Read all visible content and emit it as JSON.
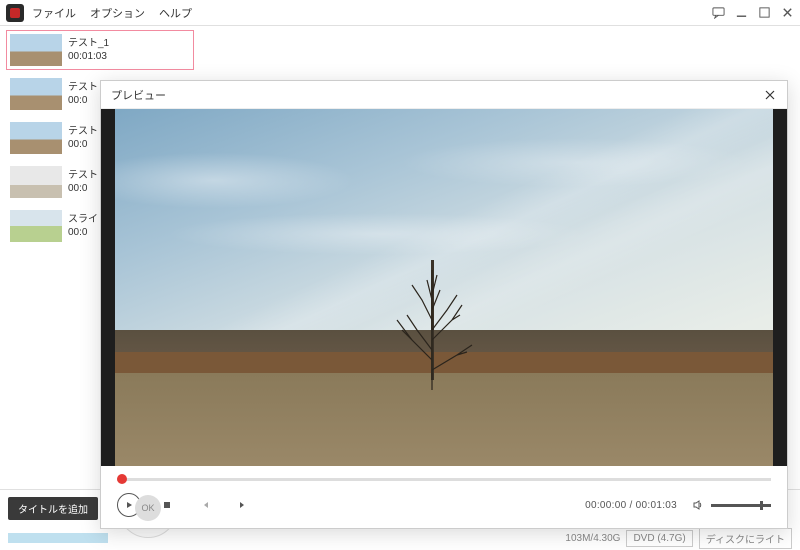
{
  "menu": {
    "file": "ファイル",
    "option": "オプション",
    "help": "ヘルプ"
  },
  "clips": [
    {
      "name": "テスト_1",
      "dur": "00:01:03",
      "sel": true
    },
    {
      "name": "テスト",
      "dur": "00:0"
    },
    {
      "name": "テスト",
      "dur": "00:0"
    },
    {
      "name": "テスト",
      "dur": "00:0"
    },
    {
      "name": "スライ",
      "dur": "00:0"
    }
  ],
  "bottom": {
    "addTitle": "タイトルを追加",
    "ok": "OK",
    "size": "103M/4.30G",
    "disc": "DVD (4.7G)",
    "out": "ディスクにライト"
  },
  "preview": {
    "title": "プレビュー",
    "time": "00:00:00 / 00:01:03"
  }
}
